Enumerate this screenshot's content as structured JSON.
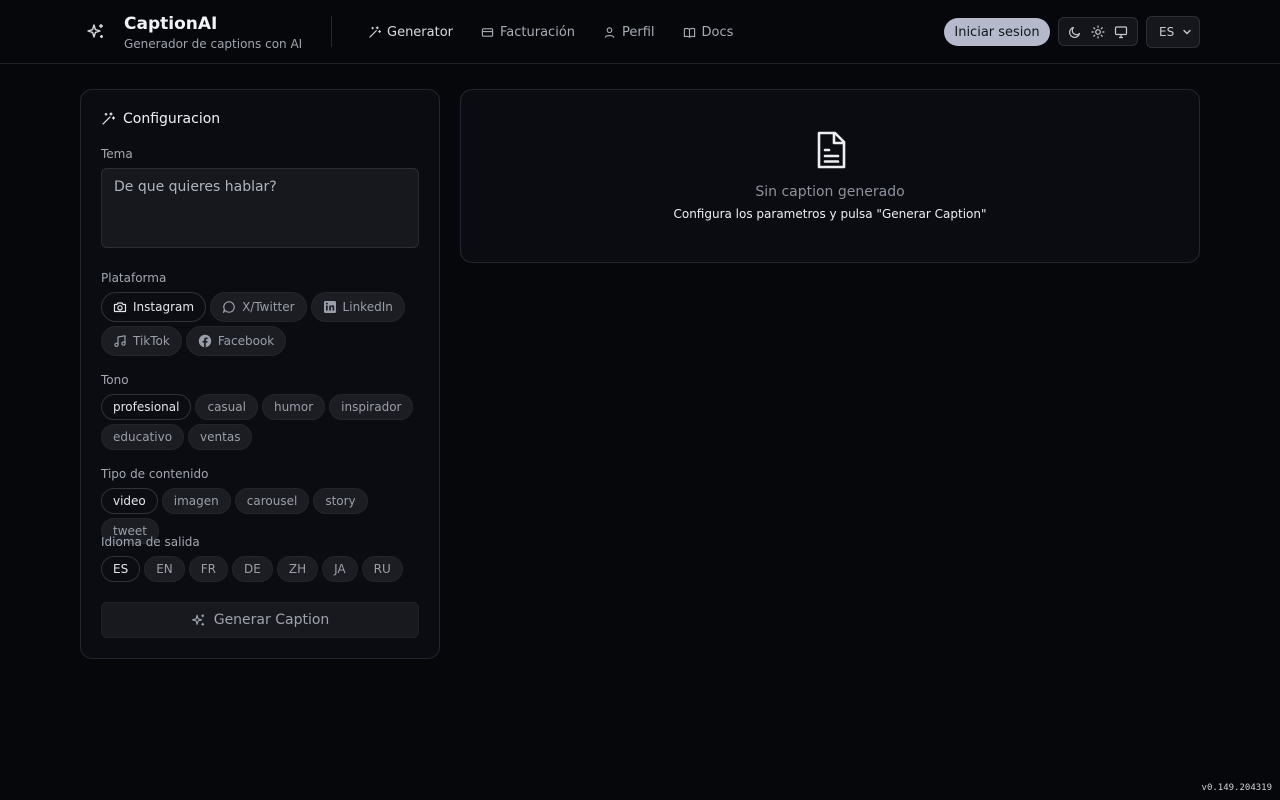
{
  "app": {
    "title": "CaptionAI",
    "subtitle": "Generador de captions con AI"
  },
  "nav": {
    "items": [
      {
        "label": "Generator",
        "icon": "magic-wand-icon",
        "active": true
      },
      {
        "label": "Facturación",
        "icon": "credit-card-icon",
        "active": false
      },
      {
        "label": "Perfil",
        "icon": "user-icon",
        "active": false
      },
      {
        "label": "Docs",
        "icon": "book-open-icon",
        "active": false
      }
    ]
  },
  "header": {
    "login_label": "Iniciar sesion",
    "language": "ES"
  },
  "config": {
    "title": "Configuracion",
    "topic_label": "Tema",
    "topic_placeholder": "De que quieres hablar?",
    "platform_label": "Plataforma",
    "platforms": [
      {
        "label": "Instagram",
        "icon": "camera-icon",
        "selected": true
      },
      {
        "label": "X/Twitter",
        "icon": "chat-bubble-icon",
        "selected": false
      },
      {
        "label": "LinkedIn",
        "icon": "linkedin-icon",
        "selected": false
      },
      {
        "label": "TikTok",
        "icon": "music-note-icon",
        "selected": false
      },
      {
        "label": "Facebook",
        "icon": "facebook-icon",
        "selected": false
      }
    ],
    "tone_label": "Tono",
    "tones": [
      {
        "label": "profesional",
        "selected": true
      },
      {
        "label": "casual",
        "selected": false
      },
      {
        "label": "humor",
        "selected": false
      },
      {
        "label": "inspirador",
        "selected": false
      },
      {
        "label": "educativo",
        "selected": false
      },
      {
        "label": "ventas",
        "selected": false
      }
    ],
    "content_type_label": "Tipo de contenido",
    "content_types": [
      {
        "label": "video",
        "selected": true
      },
      {
        "label": "imagen",
        "selected": false
      },
      {
        "label": "carousel",
        "selected": false
      },
      {
        "label": "story",
        "selected": false
      },
      {
        "label": "tweet",
        "selected": false
      }
    ],
    "output_language_label": "Idioma de salida",
    "output_languages": [
      {
        "label": "ES",
        "selected": true
      },
      {
        "label": "EN",
        "selected": false
      },
      {
        "label": "FR",
        "selected": false
      },
      {
        "label": "DE",
        "selected": false
      },
      {
        "label": "ZH",
        "selected": false
      },
      {
        "label": "JA",
        "selected": false
      },
      {
        "label": "RU",
        "selected": false
      }
    ],
    "generate_label": "Generar Caption"
  },
  "result": {
    "empty_title": "Sin caption generado",
    "empty_subtitle": "Configura los parametros y pulsa \"Generar Caption\""
  },
  "footer": {
    "version": "v0.149.204319"
  }
}
